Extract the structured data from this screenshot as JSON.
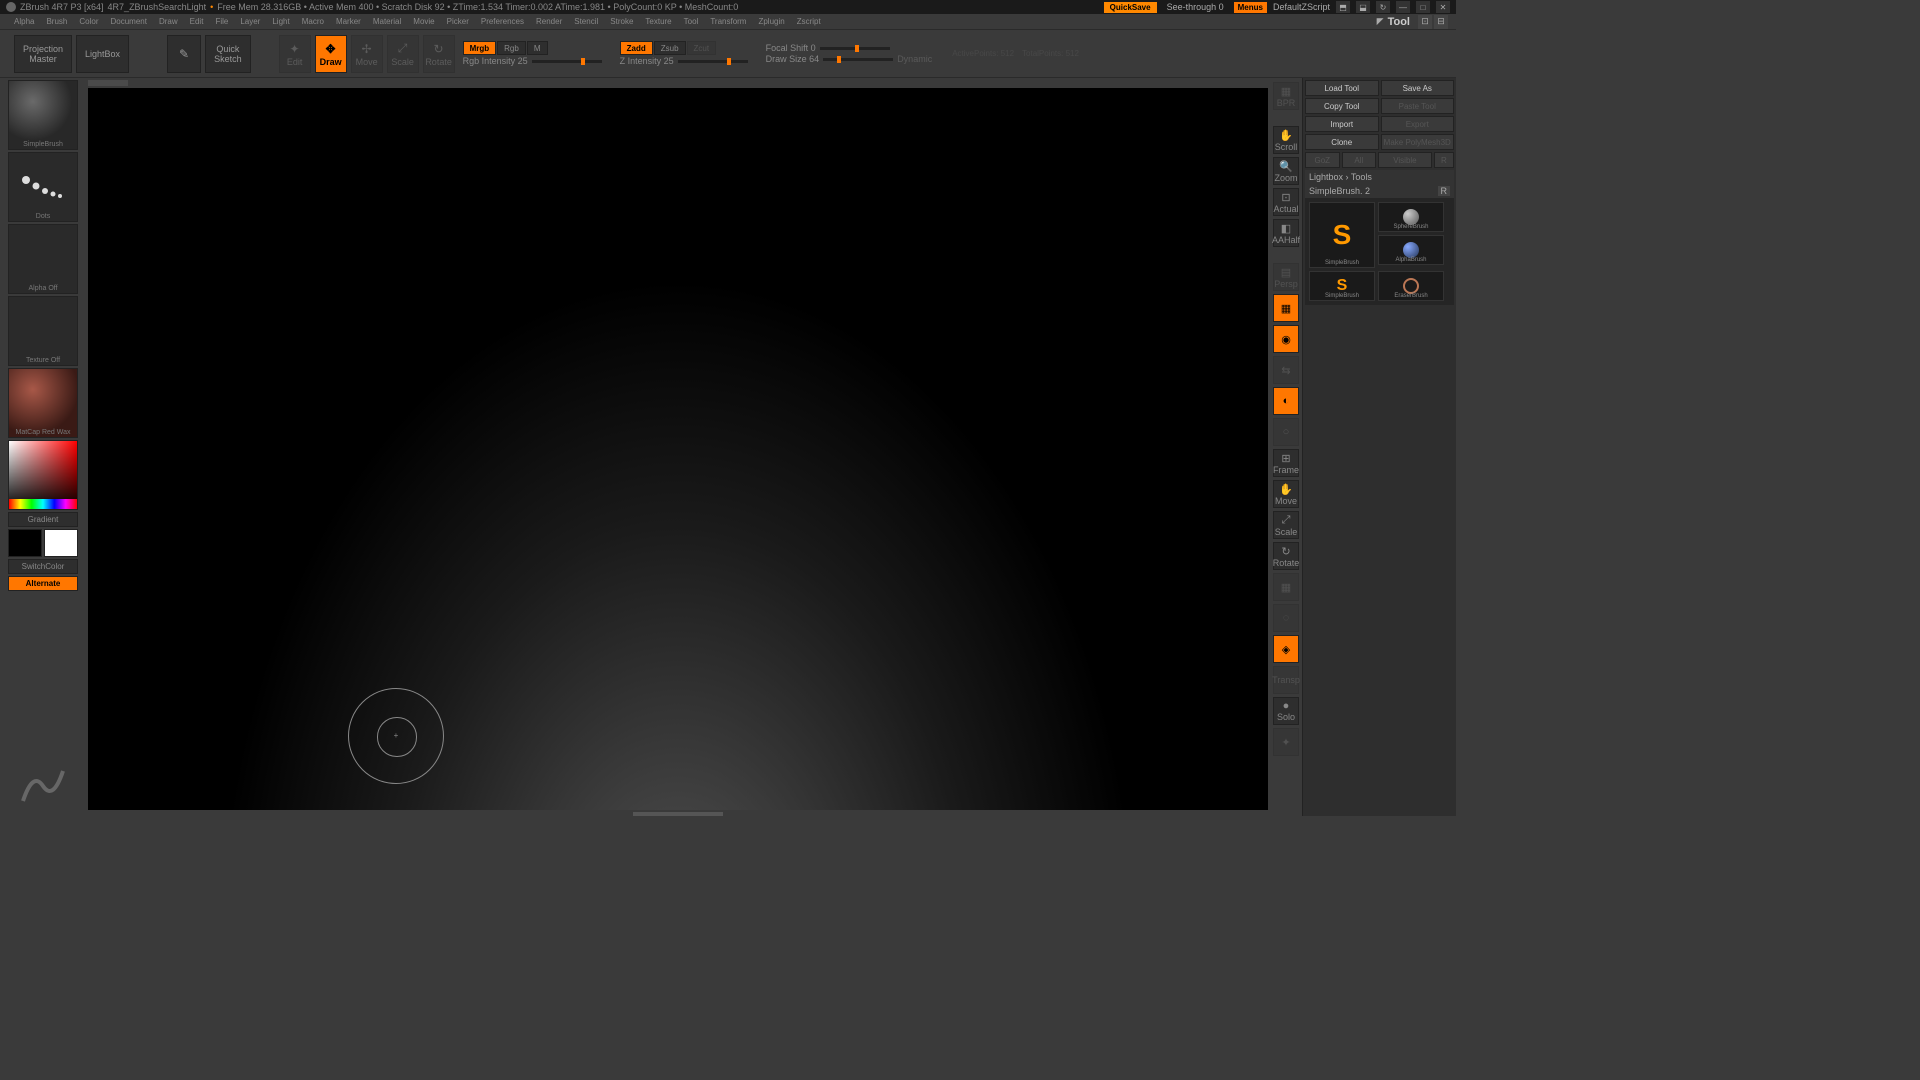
{
  "titlebar": {
    "app": "ZBrush 4R7 P3 [x64]",
    "doc": "4R7_ZBrushSearchLight",
    "stats": "Free Mem 28.316GB • Active Mem 400 • Scratch Disk 92 • ZTime:1.534 Timer:0.002 ATime:1.981 • PolyCount:0 KP • MeshCount:0",
    "quicksave": "QuickSave",
    "seethrough": "See-through  0",
    "menus": "Menus",
    "script": "DefaultZScript"
  },
  "menubar": [
    "Alpha",
    "Brush",
    "Color",
    "Document",
    "Draw",
    "Edit",
    "File",
    "Layer",
    "Light",
    "Macro",
    "Marker",
    "Material",
    "Movie",
    "Picker",
    "Preferences",
    "Render",
    "Stencil",
    "Stroke",
    "Texture",
    "Tool",
    "Transform",
    "Zplugin",
    "Zscript"
  ],
  "tool_title": "Tool",
  "toolbar": {
    "proj1": "Projection",
    "proj2": "Master",
    "lightbox": "LightBox",
    "quick1": "Quick",
    "quick2": "Sketch",
    "edit": "Edit",
    "draw": "Draw",
    "move": "Move",
    "scale": "Scale",
    "rotate": "Rotate",
    "mrgb": "Mrgb",
    "rgb": "Rgb",
    "m": "M",
    "rgb_int": "Rgb Intensity 25",
    "zadd": "Zadd",
    "zsub": "Zsub",
    "zcut": "Zcut",
    "z_int": "Z Intensity 25",
    "focal": "Focal Shift 0",
    "drawsize": "Draw Size 64",
    "dynamic": "Dynamic",
    "ap": "ActivePoints: 512",
    "tp": "TotalPoints: 512"
  },
  "left": {
    "simple": "SimpleBrush",
    "dots": "Dots",
    "alpha": "Alpha Off",
    "texture": "Texture Off",
    "material": "MatCap Red Wax",
    "gradient": "Gradient",
    "switch": "SwitchColor",
    "alternate": "Alternate"
  },
  "rightnav": {
    "bpr": "BPR",
    "scroll": "Scroll",
    "zoom": "Zoom",
    "actual": "Actual",
    "aahalf": "AAHalf",
    "persp": "Persp",
    "floor": "Floor",
    "local": "Local",
    "lc": "L.Sym",
    "frame": "Frame",
    "move": "Move",
    "scale": "Scale",
    "rotate": "Rotate",
    "pf": "PolyF",
    "transp": "Transp",
    "ghost": "Ghost",
    "solo": "Solo",
    "xpose": "Xpose"
  },
  "rightpanel": {
    "load": "Load Tool",
    "save": "Save As",
    "copy": "Copy Tool",
    "paste": "Paste Tool",
    "import": "Import",
    "export": "Export",
    "clone": "Clone",
    "make": "Make PolyMesh3D",
    "goz": "GoZ",
    "all": "All",
    "visible": "Visible",
    "r": "R",
    "lbtools": "Lightbox › Tools",
    "simple": "SimpleBrush. 2",
    "t1": "SimpleBrush",
    "t2": "SphereBrush",
    "t3": "SimpleBrush",
    "t4": "AlphaBrush",
    "t5": "EraserBrush"
  }
}
